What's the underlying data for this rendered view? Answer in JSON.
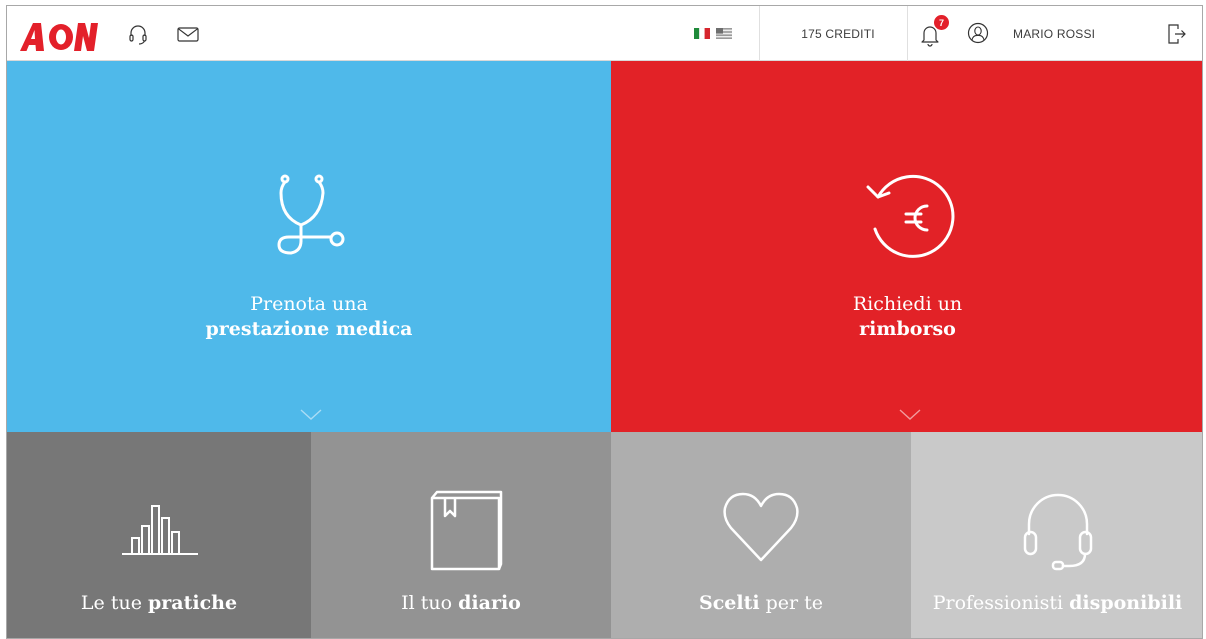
{
  "header": {
    "brand": "AON",
    "icons": [
      "headset-icon",
      "mail-icon",
      "flag-it-icon",
      "flag-us-icon",
      "bell-icon",
      "user-icon",
      "logout-icon"
    ],
    "credits": "175 CREDITI",
    "notifications_count": "7",
    "user_name": "MARIO ROSSI"
  },
  "tiles": {
    "medical": {
      "line1": "Prenota una",
      "line2": "prestazione medica",
      "icon": "stethoscope-icon"
    },
    "refund": {
      "line1": "Richiedi un",
      "line2": "rimborso",
      "icon": "euro-refund-icon"
    },
    "practices": {
      "text": "Le tue ",
      "bold": "pratiche",
      "icon": "bar-chart-icon"
    },
    "diary": {
      "text": "Il tuo ",
      "bold": "diario",
      "icon": "book-icon"
    },
    "chosen": {
      "bold": "Scelti",
      "text": " per te",
      "icon": "heart-icon"
    },
    "pros": {
      "text": "Professionisti ",
      "bold": "disponibili",
      "icon": "support-headset-icon"
    }
  },
  "colors": {
    "brand_red": "#e3202a",
    "medical_blue": "#4fb9ea",
    "refund_red": "#e22227",
    "tile_grey_1": "#777777",
    "tile_grey_2": "#939393",
    "tile_grey_3": "#aeaeae",
    "tile_grey_4": "#c9c9c9"
  }
}
